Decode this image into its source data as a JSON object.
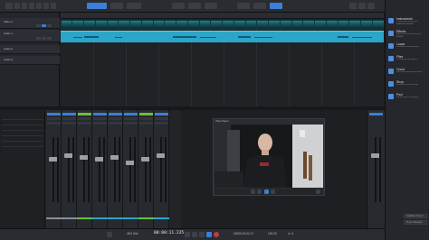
{
  "browser": {
    "items": [
      {
        "title": "Instruments",
        "sub": "Virtual instruments and instrument presets"
      },
      {
        "title": "Effects",
        "sub": "Audio and note effects and presets"
      },
      {
        "title": "Loops",
        "sub": "Audio and musical loops"
      },
      {
        "title": "Files",
        "sub": "Browse the file system"
      },
      {
        "title": "Cloud",
        "sub": "Shop and download content"
      },
      {
        "title": "Shop",
        "sub": "Browse the online shop"
      },
      {
        "title": "Pool",
        "sub": "Media used in this song"
      }
    ],
    "footer": [
      "Available Content",
      "Plug-in Manager"
    ]
  },
  "tracks": [
    {
      "label": "Video 1"
    },
    {
      "label": "Audio 1"
    },
    {
      "label": "Audio 2"
    },
    {
      "label": "Audio 3"
    }
  ],
  "player": {
    "title": "Video Player"
  },
  "transport": {
    "sample_rate": "48.0 kHz",
    "time": "00:00:11.235",
    "bars": "00005.03.02.17",
    "tempo": "120.00",
    "signature": "4 / 4"
  },
  "colors": {
    "accent": "#3b7fd9",
    "audio_clip": "#2ba5c9",
    "video_strip": "#0f3940"
  }
}
